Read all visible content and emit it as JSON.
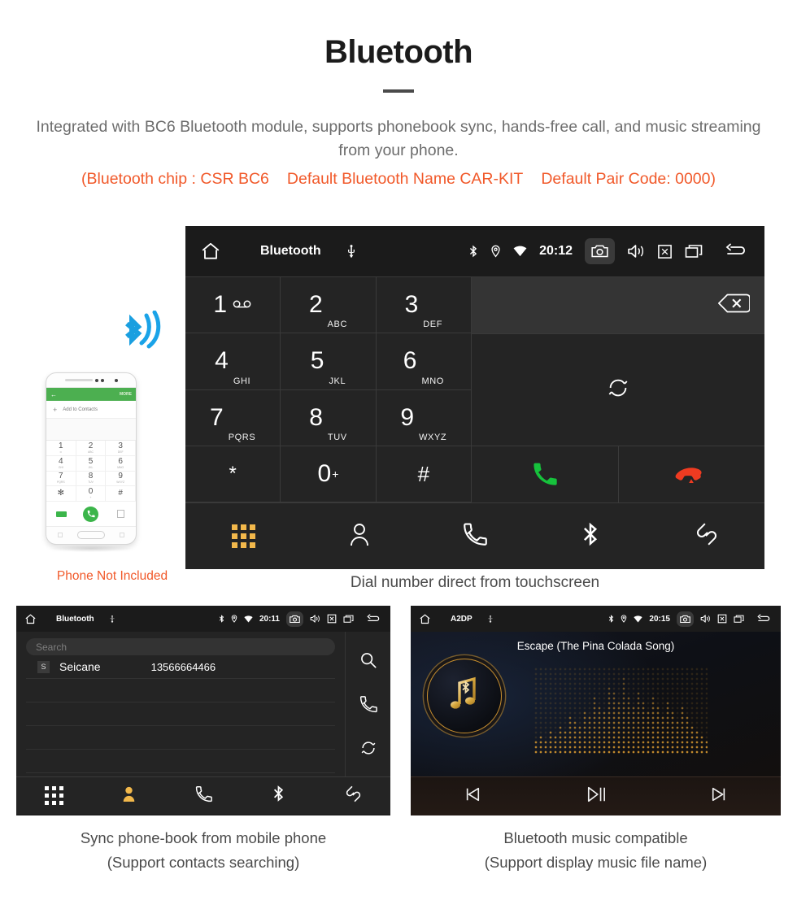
{
  "header": {
    "title": "Bluetooth",
    "description": "Integrated with BC6 Bluetooth module, supports phonebook sync, hands-free call, and music streaming from your phone.",
    "spec_chip": "(Bluetooth chip : CSR BC6",
    "spec_name": "Default Bluetooth Name CAR-KIT",
    "spec_pair": "Default Pair Code: 0000)",
    "accent_color": "#f1592a",
    "body_color": "#6d6d6d"
  },
  "phone_mockup": {
    "caption": "Phone Not Included",
    "bt_icon": "bluetooth-signal-icon",
    "screen": {
      "back_icon": "back-arrow-icon",
      "more_label": "MORE",
      "add_label": "Add to Contacts",
      "plus_icon": "plus-icon",
      "keys": [
        {
          "num": "1",
          "sub": "∞"
        },
        {
          "num": "2",
          "sub": "ABC"
        },
        {
          "num": "3",
          "sub": "DEF"
        },
        {
          "num": "4",
          "sub": "GHI"
        },
        {
          "num": "5",
          "sub": "JKL"
        },
        {
          "num": "6",
          "sub": "MNO"
        },
        {
          "num": "7",
          "sub": "PQRS"
        },
        {
          "num": "8",
          "sub": "TUV"
        },
        {
          "num": "9",
          "sub": "WXYZ"
        },
        {
          "num": "*",
          "sub": ""
        },
        {
          "num": "0",
          "sub": "+"
        },
        {
          "num": "#",
          "sub": ""
        }
      ]
    }
  },
  "dialer": {
    "caption": "Dial number direct from touchscreen",
    "statusbar": {
      "home_icon": "home-icon",
      "title": "Bluetooth",
      "usb_icon": "usb-icon",
      "bluetooth_icon": "bluetooth-icon",
      "location_icon": "location-pin-icon",
      "wifi_icon": "wifi-icon",
      "time": "20:12",
      "camera_icon": "camera-icon",
      "volume_icon": "volume-icon",
      "close_icon": "close-box-icon",
      "recents_icon": "recents-icon",
      "back_icon": "back-icon"
    },
    "keys": [
      {
        "num": "1",
        "sub": "",
        "vm": true
      },
      {
        "num": "2",
        "sub": "ABC"
      },
      {
        "num": "3",
        "sub": "DEF"
      },
      {
        "num": "4",
        "sub": "GHI"
      },
      {
        "num": "5",
        "sub": "JKL"
      },
      {
        "num": "6",
        "sub": "MNO"
      },
      {
        "num": "7",
        "sub": "PQRS"
      },
      {
        "num": "8",
        "sub": "TUV"
      },
      {
        "num": "9",
        "sub": "WXYZ"
      },
      {
        "num": "*",
        "sub": ""
      },
      {
        "num": "0",
        "sub": "+"
      },
      {
        "num": "#",
        "sub": ""
      }
    ],
    "number_value": "",
    "backspace_icon": "backspace-icon",
    "sync_icon": "sync-icon",
    "call_icon": "call-green-icon",
    "hangup_icon": "hangup-red-icon",
    "tabs": [
      {
        "name": "keypad",
        "icon": "keypad-grid-icon",
        "active": true
      },
      {
        "name": "contacts",
        "icon": "person-icon",
        "active": false
      },
      {
        "name": "call-log",
        "icon": "handset-icon",
        "active": false
      },
      {
        "name": "bluetooth",
        "icon": "bluetooth-icon",
        "active": false
      },
      {
        "name": "pair",
        "icon": "link-icon",
        "active": false
      }
    ]
  },
  "phonebook": {
    "caption_line1": "Sync phone-book from mobile phone",
    "caption_line2": "(Support contacts searching)",
    "statusbar": {
      "title": "Bluetooth",
      "time": "20:11"
    },
    "search_placeholder": "Search",
    "contacts": [
      {
        "initial": "S",
        "name": "Seicane",
        "number": "13566664466"
      }
    ],
    "side_icons": [
      "search-icon",
      "handset-icon",
      "sync-icon"
    ],
    "tabs": [
      {
        "name": "keypad",
        "icon": "keypad-grid-icon",
        "active": false
      },
      {
        "name": "contacts",
        "icon": "person-icon",
        "active": true
      },
      {
        "name": "call-log",
        "icon": "handset-icon",
        "active": false
      },
      {
        "name": "bluetooth",
        "icon": "bluetooth-icon",
        "active": false
      },
      {
        "name": "pair",
        "icon": "link-icon",
        "active": false
      }
    ]
  },
  "music": {
    "caption_line1": "Bluetooth music compatible",
    "caption_line2": "(Support display music file name)",
    "statusbar": {
      "title": "A2DP",
      "time": "20:15"
    },
    "song_title": "Escape (The Pina Colada Song)",
    "album_art_icon": "music-note-bluetooth-icon",
    "visualizer": "dot-matrix-spectrum",
    "accent_color": "#c98f2e",
    "controls": [
      {
        "name": "previous",
        "icon": "skip-previous-icon"
      },
      {
        "name": "play-pause",
        "icon": "play-pause-icon"
      },
      {
        "name": "next",
        "icon": "skip-next-icon"
      }
    ]
  }
}
